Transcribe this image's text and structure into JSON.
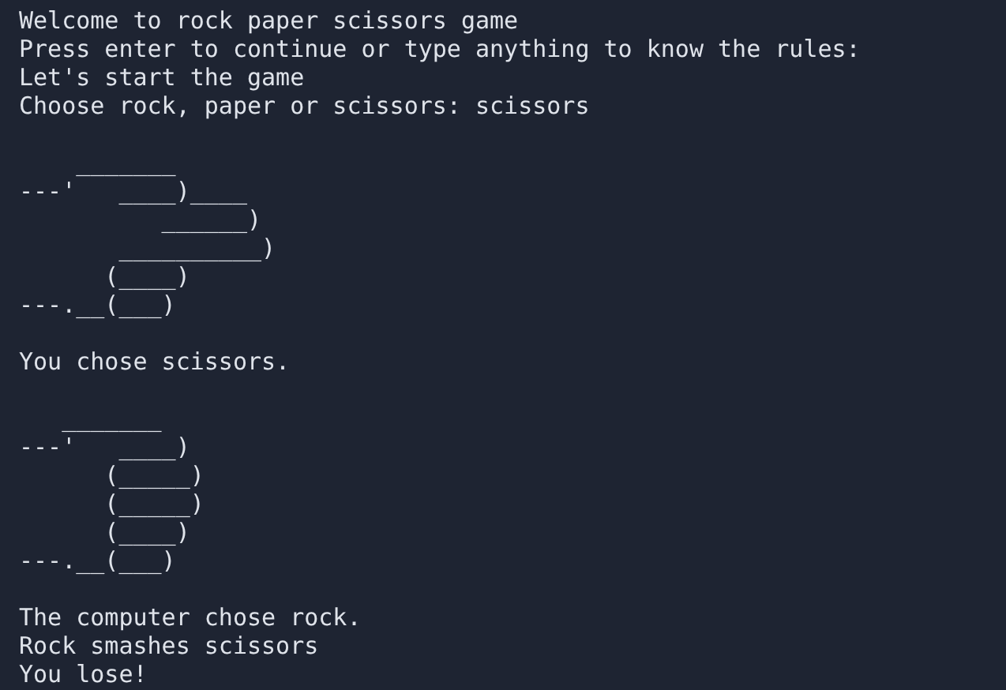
{
  "terminal": {
    "blocks": [
      {
        "lines": [
          "Welcome to rock paper scissors game",
          "Press enter to continue or type anything to know the rules:",
          "Let's start the game",
          "Choose rock, paper or scissors: scissors"
        ]
      },
      {
        "lines": [
          "    _______",
          "---'   ____)____",
          "          ______)",
          "       __________)",
          "      (____)",
          "---.__(___)"
        ]
      },
      {
        "lines": [
          "You chose scissors."
        ]
      },
      {
        "lines": [
          "   _______",
          "---'   ____)",
          "      (_____)",
          "      (_____)",
          "      (____)",
          "---.__(___)"
        ]
      },
      {
        "lines": [
          "The computer chose rock.",
          "Rock smashes scissors",
          "You lose!"
        ]
      }
    ]
  }
}
